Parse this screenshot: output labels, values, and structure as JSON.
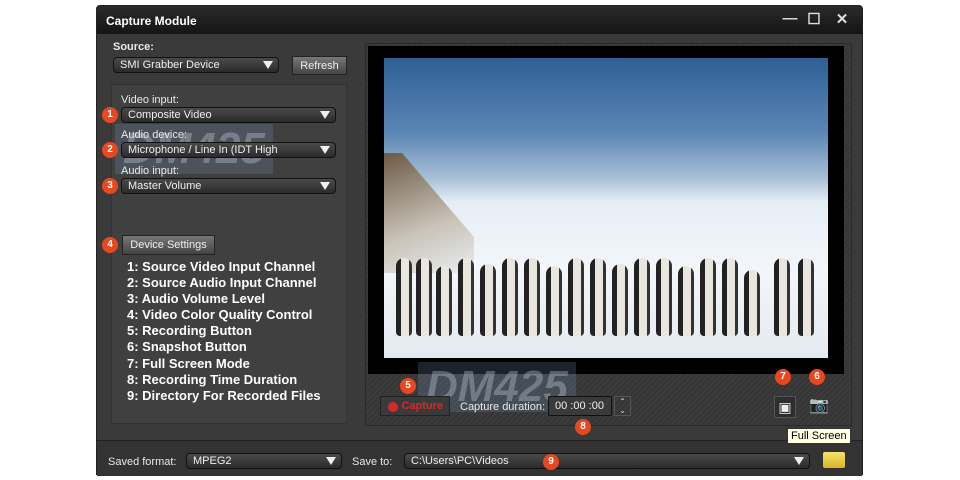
{
  "window": {
    "title": "Capture Module"
  },
  "source": {
    "label": "Source:",
    "value": "SMI Grabber Device",
    "refresh": "Refresh"
  },
  "video_input": {
    "label": "Video input:",
    "value": "Composite Video"
  },
  "audio_device": {
    "label": "Audio device:",
    "value": "Microphone / Line In (IDT High"
  },
  "audio_input": {
    "label": "Audio input:",
    "value": "Master Volume"
  },
  "device_settings": "Device Settings",
  "legend": [
    "1: Source Video Input Channel",
    "2: Source Audio Input Channel",
    "3: Audio Volume Level",
    "4: Video Color Quality Control",
    "5: Recording Button",
    "6: Snapshot Button",
    "7: Full Screen Mode",
    "8: Recording Time Duration",
    "9: Directory For Recorded Files"
  ],
  "badges": [
    "1",
    "2",
    "3",
    "4",
    "5",
    "6",
    "7",
    "8",
    "9"
  ],
  "watermark": "DM425",
  "capture": {
    "button": "Capture",
    "duration_label": "Capture duration:",
    "duration": "00 :00 :00"
  },
  "tooltip": "Full Screen",
  "bottom": {
    "format_label": "Saved format:",
    "format": "MPEG2",
    "save_label": "Save to:",
    "path": "C:\\Users\\PC\\Videos"
  },
  "colors": {
    "badge": "#e8481f",
    "record": "#d42a2a"
  }
}
